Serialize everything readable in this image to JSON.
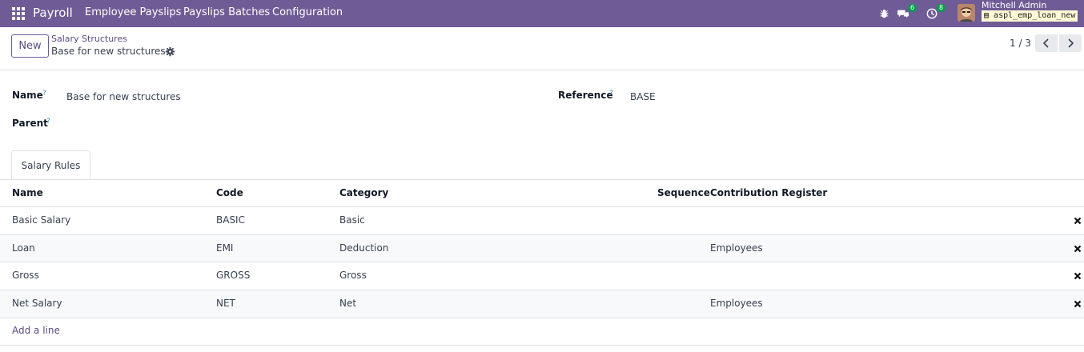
{
  "navbar": {
    "app_name": "Payroll",
    "menu": [
      "Employee Payslips",
      "Payslips Batches",
      "Configuration"
    ],
    "chat_count": "6",
    "activity_count": "8",
    "user_name": "Mitchell Admin",
    "database": "aspl_emp_loan_new"
  },
  "control": {
    "new_label": "New",
    "breadcrumb_parent": "Salary Structures",
    "breadcrumb_current": "Base for new structures",
    "pager": "1 / 3"
  },
  "form": {
    "name_label": "Name",
    "name_value": "Base for new structures",
    "reference_label": "Reference",
    "reference_value": "BASE",
    "parent_label": "Parent",
    "help_mark": "?"
  },
  "tabs": [
    "Salary Rules"
  ],
  "table": {
    "headers": [
      "Name",
      "Code",
      "Category",
      "Sequence",
      "Contribution Register"
    ],
    "rows": [
      {
        "name": "Basic Salary",
        "code": "BASIC",
        "category": "Basic",
        "sequence": "",
        "register": ""
      },
      {
        "name": "Loan",
        "code": "EMI",
        "category": "Deduction",
        "sequence": "",
        "register": "Employees"
      },
      {
        "name": "Gross",
        "code": "GROSS",
        "category": "Gross",
        "sequence": "",
        "register": ""
      },
      {
        "name": "Net Salary",
        "code": "NET",
        "category": "Net",
        "sequence": "",
        "register": "Employees"
      }
    ],
    "add_line": "Add a line"
  }
}
